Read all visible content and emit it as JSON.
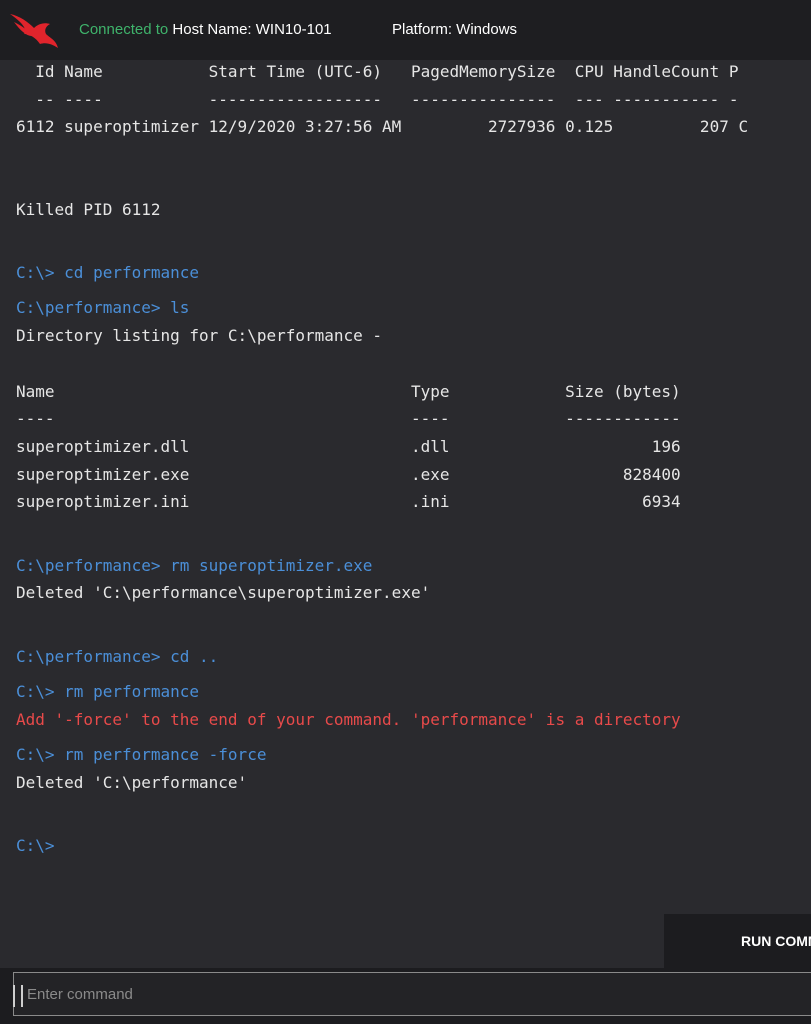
{
  "header": {
    "connected": "Connected to",
    "host": "Host Name: WIN10-101",
    "platform": "Platform: Windows"
  },
  "console": {
    "lines": [
      {
        "text": "  Id Name           Start Time (UTC-6)   PagedMemorySize  CPU HandleCount P",
        "kind": "out"
      },
      {
        "text": "  -- ----           ------------------   ---------------  --- ----------- -",
        "kind": "out"
      },
      {
        "text": "6112 superoptimizer 12/9/2020 3:27:56 AM         2727936 0.125         207 C",
        "kind": "out"
      },
      {
        "text": "Killed PID 6112",
        "kind": "out"
      },
      {
        "text": "C:\\> cd performance",
        "kind": "cmd"
      },
      {
        "text": "C:\\performance> ls",
        "kind": "cmd"
      },
      {
        "text": "Directory listing for C:\\performance -",
        "kind": "out"
      },
      {
        "text": "Name                                     Type            Size (bytes)",
        "kind": "out"
      },
      {
        "text": "----                                     ----            ------------",
        "kind": "out"
      },
      {
        "text": "superoptimizer.dll                       .dll                     196",
        "kind": "out"
      },
      {
        "text": "superoptimizer.exe                       .exe                  828400",
        "kind": "out"
      },
      {
        "text": "superoptimizer.ini                       .ini                    6934",
        "kind": "out"
      },
      {
        "text": "C:\\performance> rm superoptimizer.exe",
        "kind": "cmd"
      },
      {
        "text": "Deleted 'C:\\performance\\superoptimizer.exe'",
        "kind": "out"
      },
      {
        "text": "C:\\performance> cd ..",
        "kind": "cmd"
      },
      {
        "text": "C:\\> rm performance",
        "kind": "cmd"
      },
      {
        "text": "Add '-force' to the end of your command. 'performance' is a directory",
        "kind": "err"
      },
      {
        "text": "C:\\> rm performance -force",
        "kind": "cmd"
      },
      {
        "text": "Deleted 'C:\\performance'",
        "kind": "out"
      },
      {
        "text": "C:\\>",
        "kind": "cmd"
      }
    ]
  },
  "run_button": {
    "label": "RUN COMMAND"
  },
  "command_input": {
    "placeholder": "Enter command",
    "value": ""
  },
  "colors": {
    "command": "#4b8fd8",
    "error": "#e84a4a",
    "connected": "#3fb36b",
    "logo": "#e0242c"
  }
}
